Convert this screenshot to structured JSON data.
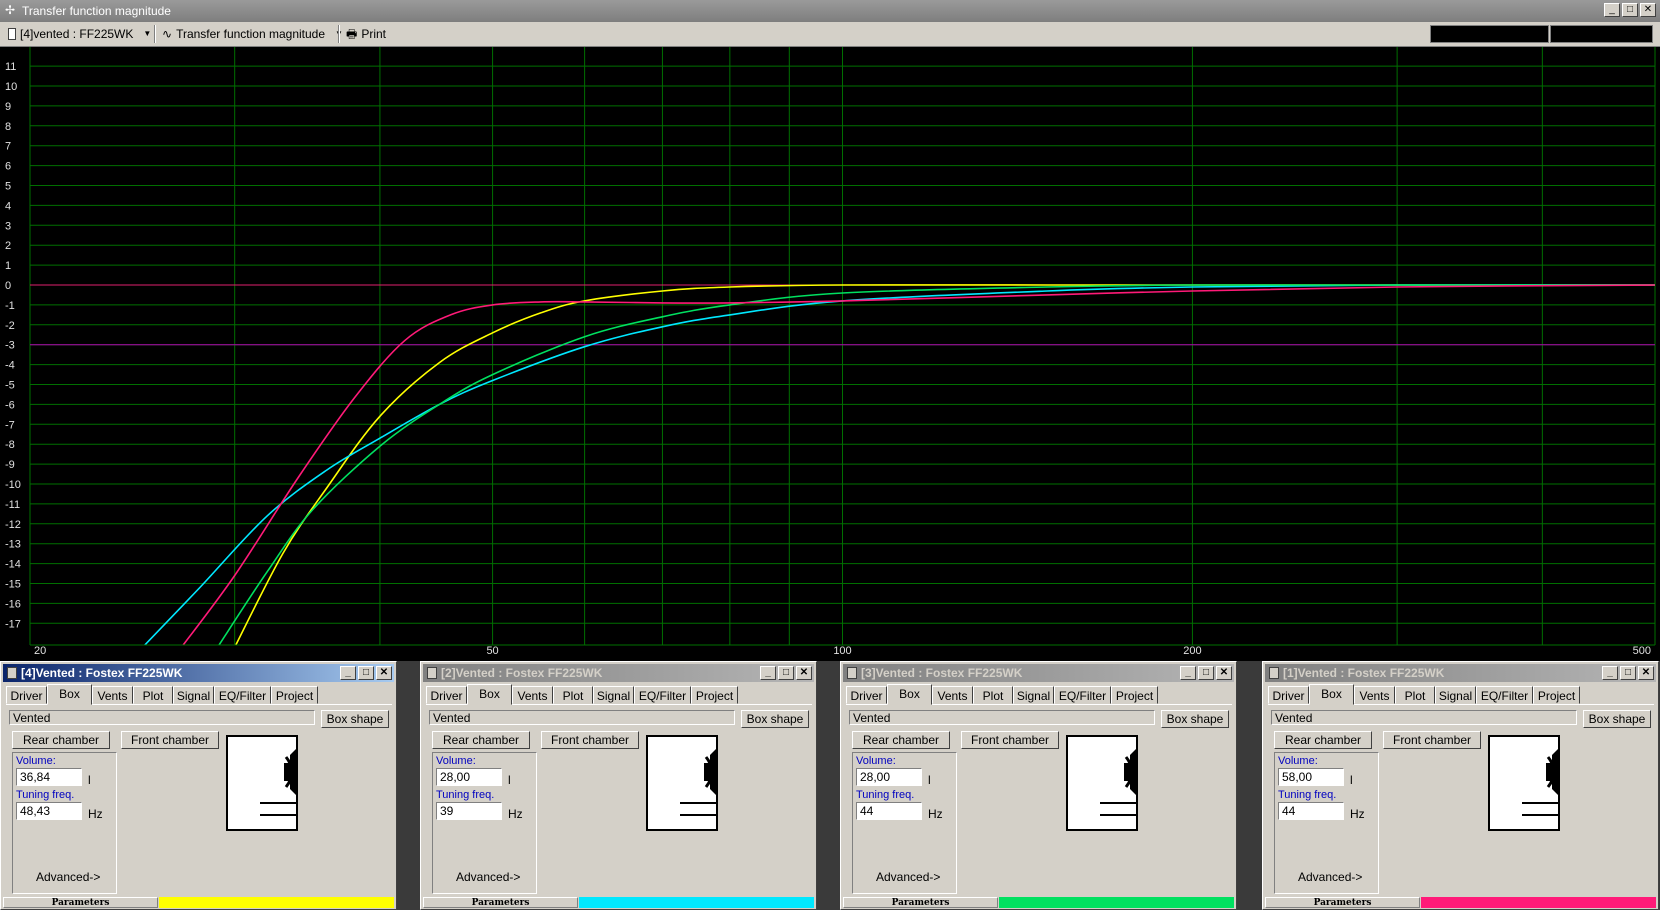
{
  "window": {
    "title": "Transfer function magnitude"
  },
  "toolbar": {
    "project_select": "[4]vented : FF225WK",
    "view_select": "Transfer function magnitude",
    "print_label": "Print"
  },
  "chart_data": {
    "type": "line",
    "title": "",
    "xlabel": "",
    "ylabel": "",
    "x_scale": "log",
    "xlim": [
      20,
      500
    ],
    "ylim": [
      -18,
      12
    ],
    "x_tick_labels": [
      "20",
      "50",
      "100",
      "200",
      "500"
    ],
    "x_ticks": [
      20,
      50,
      100,
      200,
      500
    ],
    "x_grid": [
      20,
      30,
      40,
      50,
      60,
      70,
      80,
      90,
      100,
      200,
      300,
      400
    ],
    "y_ticks": [
      11,
      10,
      9,
      8,
      7,
      6,
      5,
      4,
      3,
      2,
      1,
      0,
      -1,
      -2,
      -3,
      -4,
      -5,
      -6,
      -7,
      -8,
      -9,
      -10,
      -11,
      -12,
      -13,
      -14,
      -15,
      -16,
      -17
    ],
    "grid": true,
    "reference_lines": [
      {
        "y": 0,
        "color": "#e0206e"
      },
      {
        "y": -3,
        "color": "#b000b0"
      }
    ],
    "series": [
      {
        "color": "#ffff00",
        "x": [
          30,
          33,
          36,
          40,
          45,
          50,
          55,
          60,
          70,
          80,
          100,
          150,
          200,
          300,
          500
        ],
        "y": [
          -18.2,
          -13.5,
          -10.2,
          -6.6,
          -3.9,
          -2.4,
          -1.4,
          -0.8,
          -0.3,
          -0.1,
          0,
          0,
          0,
          0,
          0
        ]
      },
      {
        "color": "#00e8ff",
        "x": [
          25,
          28,
          32,
          36,
          40,
          45,
          50,
          60,
          70,
          80,
          100,
          150,
          200,
          300,
          500
        ],
        "y": [
          -18.2,
          -15.2,
          -11.6,
          -9.3,
          -7.7,
          -6.0,
          -4.8,
          -3.1,
          -2.1,
          -1.5,
          -0.8,
          -0.3,
          -0.1,
          0,
          0
        ]
      },
      {
        "color": "#00e060",
        "x": [
          29,
          32,
          35,
          40,
          45,
          50,
          60,
          70,
          80,
          100,
          150,
          200,
          300,
          500
        ],
        "y": [
          -18.2,
          -14.4,
          -11.3,
          -8.1,
          -6.0,
          -4.5,
          -2.6,
          -1.6,
          -1.0,
          -0.4,
          -0.1,
          0,
          0,
          0
        ]
      },
      {
        "color": "#ff1a78",
        "x": [
          27,
          30,
          34,
          38,
          42,
          46,
          50,
          55,
          60,
          70,
          80,
          100,
          150,
          200,
          300,
          500
        ],
        "y": [
          -18.2,
          -14.6,
          -9.7,
          -5.7,
          -2.8,
          -1.5,
          -1.0,
          -0.85,
          -0.85,
          -0.9,
          -0.9,
          -0.8,
          -0.5,
          -0.3,
          -0.1,
          0
        ]
      }
    ]
  },
  "panels": [
    {
      "title": "[4]Vented : Fostex FF225WK",
      "active": true,
      "box_type": "Vented",
      "box_shape_label": "Box shape",
      "volume_label": "Volume:",
      "volume": "36,84",
      "volume_unit": "l",
      "tuning_label": "Tuning freq.",
      "tuning": "48,43",
      "tuning_unit": "Hz",
      "advanced_label": "Advanced->",
      "status_label": "Parameters",
      "color": "#ffff00"
    },
    {
      "title": "[2]Vented : Fostex FF225WK",
      "active": false,
      "box_type": "Vented",
      "box_shape_label": "Box shape",
      "volume_label": "Volume:",
      "volume": "28,00",
      "volume_unit": "l",
      "tuning_label": "Tuning freq.",
      "tuning": "39",
      "tuning_unit": "Hz",
      "advanced_label": "Advanced->",
      "status_label": "Parameters",
      "color": "#00e8ff"
    },
    {
      "title": "[3]Vented : Fostex FF225WK",
      "active": false,
      "box_type": "Vented",
      "box_shape_label": "Box shape",
      "volume_label": "Volume:",
      "volume": "28,00",
      "volume_unit": "l",
      "tuning_label": "Tuning freq.",
      "tuning": "44",
      "tuning_unit": "Hz",
      "advanced_label": "Advanced->",
      "status_label": "Parameters",
      "color": "#00e060"
    },
    {
      "title": "[1]Vented : Fostex FF225WK",
      "active": false,
      "box_type": "Vented",
      "box_shape_label": "Box shape",
      "volume_label": "Volume:",
      "volume": "58,00",
      "volume_unit": "l",
      "tuning_label": "Tuning freq.",
      "tuning": "44",
      "tuning_unit": "Hz",
      "advanced_label": "Advanced->",
      "status_label": "Parameters",
      "color": "#ff1a78"
    }
  ],
  "tabs": [
    "Driver",
    "Box",
    "Vents",
    "Plot",
    "Signal",
    "EQ/Filter",
    "Project"
  ],
  "chamber_buttons": {
    "rear": "Rear chamber",
    "front": "Front chamber"
  }
}
